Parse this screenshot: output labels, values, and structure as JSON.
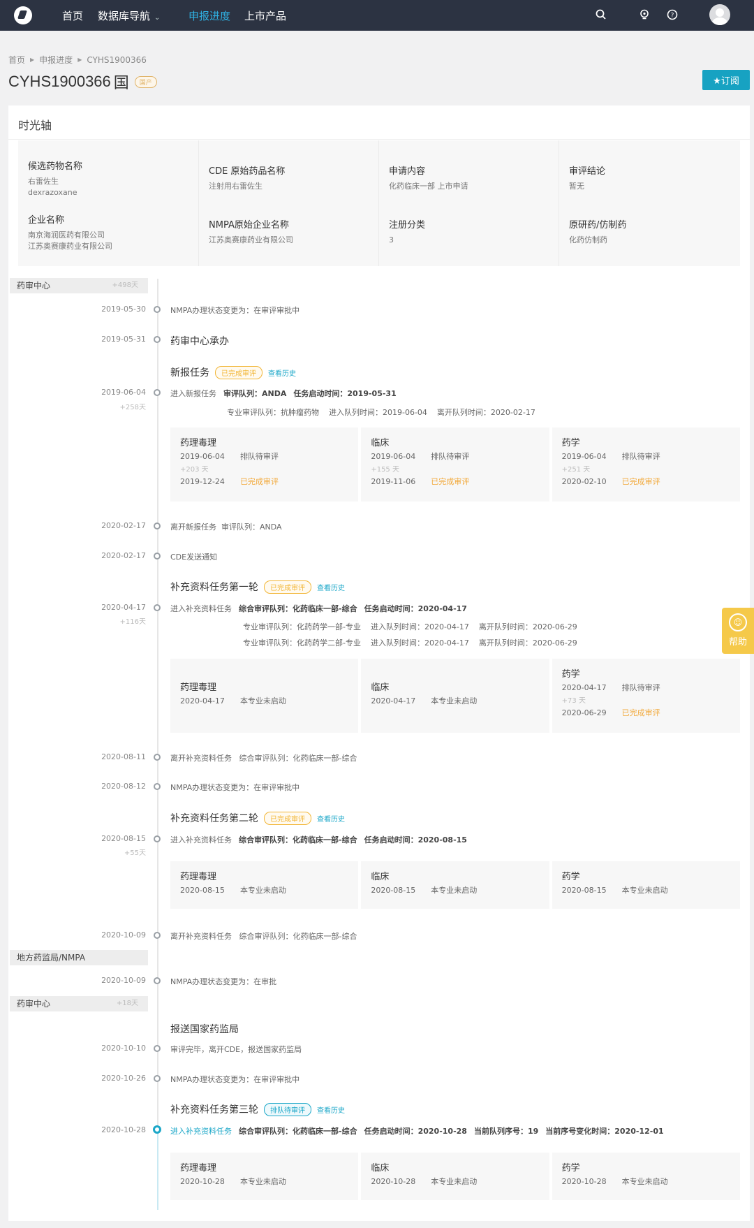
{
  "nav": {
    "items": [
      "首页",
      "数据库导航",
      "申报进度",
      "上市产品"
    ],
    "active": "申报进度"
  },
  "breadcrumb": [
    "首页",
    "申报进度",
    "CYHS1900366"
  ],
  "title": {
    "code": "CYHS1900366",
    "flag": "国",
    "tag": "国产"
  },
  "subscribe": "★订阅",
  "card_title": "时光轴",
  "info": [
    [
      {
        "label": "候选药物名称",
        "values": [
          "右雷佐生",
          "dexrazoxane"
        ]
      },
      {
        "label": "企业名称",
        "values": [
          "南京海润医药有限公司",
          "江苏奥赛康药业有限公司"
        ]
      }
    ],
    [
      {
        "label": "CDE 原始药品名称",
        "values": [
          "注射用右雷佐生"
        ]
      },
      {
        "label": "NMPA原始企业名称",
        "values": [
          "江苏奥赛康药业有限公司"
        ]
      }
    ],
    [
      {
        "label": "申请内容",
        "values": [
          "化药临床一部 上市申请"
        ]
      },
      {
        "label": "注册分类",
        "values": [
          "3"
        ]
      }
    ],
    [
      {
        "label": "审评结论",
        "values": [
          "暂无"
        ]
      },
      {
        "label": "原研药/仿制药",
        "values": [
          "化药仿制药"
        ]
      }
    ]
  ],
  "groups": [
    {
      "label": "药审中心",
      "days": "+498天"
    },
    {
      "label": "地方药监局/NMPA",
      "days": ""
    },
    {
      "label": "药审中心",
      "days": "+18天"
    }
  ],
  "events": {
    "e1": {
      "date": "2019-05-30",
      "text": "NMPA办理状态变更为：在审评审批中"
    },
    "e2": {
      "date": "2019-05-31",
      "title": "药审中心承办"
    },
    "t1": {
      "title": "新报任务",
      "status": "已完成审评",
      "history": "查看历史"
    },
    "e3": {
      "date": "2019-06-04",
      "days": "+258天",
      "line1": [
        "进入新报任务",
        "审评队列：ANDA",
        "任务启动时间：2019-05-31"
      ],
      "line2": "专业审评队列：抗肿瘤药物    进入队列时间：2019-06-04    离开队列时间：2020-02-17"
    },
    "e4": {
      "date": "2020-02-17",
      "text": "离开新报任务  审评队列：ANDA"
    },
    "e5": {
      "date": "2020-02-17",
      "text": "CDE发送通知"
    },
    "t2": {
      "title": "补充资料任务第一轮",
      "status": "已完成审评",
      "history": "查看历史"
    },
    "e6": {
      "date": "2020-04-17",
      "days": "+116天",
      "line1": [
        "进入补充资料任务",
        "综合审评队列：化药临床一部-综合",
        "任务启动时间：2020-04-17"
      ],
      "line2": "专业审评队列：化药药学一部-专业    进入队列时间：2020-04-17    离开队列时间：2020-06-29",
      "line3": "专业审评队列：化药药学二部-专业    进入队列时间：2020-04-17    离开队列时间：2020-06-29"
    },
    "e7": {
      "date": "2020-08-11",
      "text": "离开补充资料任务   综合审评队列：化药临床一部-综合"
    },
    "e8": {
      "date": "2020-08-12",
      "text": "NMPA办理状态变更为：在审评审批中"
    },
    "t3": {
      "title": "补充资料任务第二轮",
      "status": "已完成审评",
      "history": "查看历史"
    },
    "e9": {
      "date": "2020-08-15",
      "days": "+55天",
      "line1": [
        "进入补充资料任务",
        "综合审评队列：化药临床一部-综合",
        "任务启动时间：2020-08-15"
      ]
    },
    "e10": {
      "date": "2020-10-09",
      "text": "离开补充资料任务   综合审评队列：化药临床一部-综合"
    },
    "e11": {
      "date": "2020-10-09",
      "text": "NMPA办理状态变更为：在审批"
    },
    "e12": {
      "title": "报送国家药监局"
    },
    "e13": {
      "date": "2020-10-10",
      "text": "审评完毕，离开CDE，报送国家药监局"
    },
    "e14": {
      "date": "2020-10-26",
      "text": "NMPA办理状态变更为：在审评审批中"
    },
    "t4": {
      "title": "补充资料任务第三轮",
      "status": "排队待审评",
      "history": "查看历史"
    },
    "e15": {
      "date": "2020-10-28",
      "line1": [
        "进入补充资料任务",
        "综合审评队列：化药临床一部-综合",
        "任务启动时间：2020-10-28",
        "当前队列序号：19",
        "当前序号变化时间：2020-12-01"
      ]
    }
  },
  "panels": {
    "p1": [
      {
        "title": "药理毒理",
        "r1d": "2019-06-04",
        "r1s": "排队待审评",
        "days": "+203 天",
        "r2d": "2019-12-24",
        "r2s": "已完成审评"
      },
      {
        "title": "临床",
        "r1d": "2019-06-04",
        "r1s": "排队待审评",
        "days": "+155 天",
        "r2d": "2019-11-06",
        "r2s": "已完成审评"
      },
      {
        "title": "药学",
        "r1d": "2019-06-04",
        "r1s": "排队待审评",
        "days": "+251 天",
        "r2d": "2020-02-10",
        "r2s": "已完成审评"
      }
    ],
    "p2": [
      {
        "title": "药理毒理",
        "r1d": "2020-04-17",
        "r1s": "本专业未启动"
      },
      {
        "title": "临床",
        "r1d": "2020-04-17",
        "r1s": "本专业未启动"
      },
      {
        "title": "药学",
        "r1d": "2020-04-17",
        "r1s": "排队待审评",
        "days": "+73 天",
        "r2d": "2020-06-29",
        "r2s": "已完成审评"
      }
    ],
    "p3": [
      {
        "title": "药理毒理",
        "r1d": "2020-08-15",
        "r1s": "本专业未启动"
      },
      {
        "title": "临床",
        "r1d": "2020-08-15",
        "r1s": "本专业未启动"
      },
      {
        "title": "药学",
        "r1d": "2020-08-15",
        "r1s": "本专业未启动"
      }
    ],
    "p4": [
      {
        "title": "药理毒理",
        "r1d": "2020-10-28",
        "r1s": "本专业未启动"
      },
      {
        "title": "临床",
        "r1d": "2020-10-28",
        "r1s": "本专业未启动"
      },
      {
        "title": "药学",
        "r1d": "2020-10-28",
        "r1s": "本专业未启动"
      }
    ]
  },
  "help": "帮助",
  "colors": {
    "nav_bg": "#2c3342",
    "accent": "#1ba7c8",
    "done": "#f2a93b",
    "help": "#f5c94a"
  }
}
